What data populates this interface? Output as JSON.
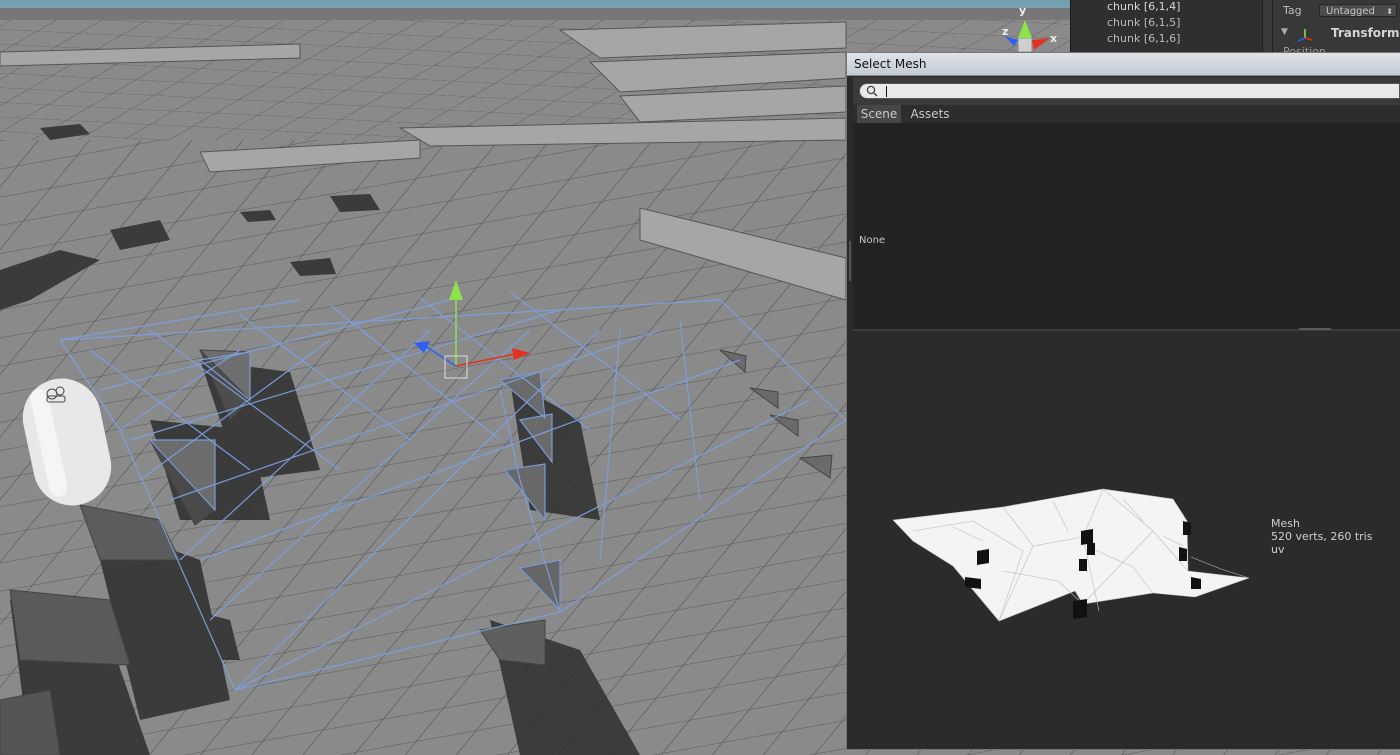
{
  "hierarchy": {
    "items": [
      "chunk [6,1,4]",
      "chunk [6,1,5]",
      "chunk [6,1,6]"
    ]
  },
  "inspector": {
    "tag_label": "Tag",
    "tag_value": "Untagged",
    "component_title": "Transform",
    "position_label": "Position"
  },
  "scene_gizmo": {
    "axes": [
      "y",
      "z",
      "x"
    ]
  },
  "select_mesh": {
    "title": "Select Mesh",
    "search": {
      "value": "",
      "placeholder": ""
    },
    "tabs": [
      "Scene",
      "Assets"
    ],
    "selected_tab": "Scene",
    "items": [
      "None"
    ],
    "preview": {
      "name": "Mesh",
      "stats": "520 verts, 260 tris",
      "channels": "uv"
    }
  },
  "colors": {
    "window_bg": "#232323",
    "titlebar": "#d3d8e0",
    "wireframe": "#7da0e0",
    "gizmo_y": "#8fe34a",
    "gizmo_x": "#e0321e",
    "gizmo_z": "#2e5ff0"
  }
}
